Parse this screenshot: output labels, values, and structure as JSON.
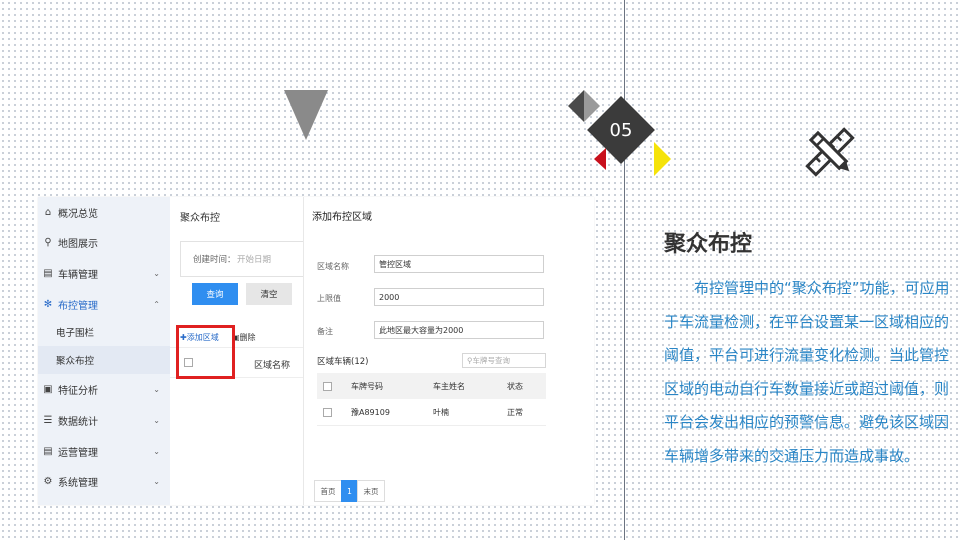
{
  "slide": {
    "number": "05",
    "title": "聚众布控",
    "description": "布控管理中的“聚众布控”功能，可应用于车流量检测，在平台设置某一区域相应的阈值，平台可进行流量变化检测。当此管控区域的电动自行车数量接近或超过阈值，则平台会发出相应的预警信息。避免该区域因车辆增多带来的交通压力而造成事故。",
    "icon": "ruler-pencil-icon",
    "colors": {
      "accent_red": "#c8101c",
      "accent_yellow": "#f5e30a",
      "text_blue": "#2a86c6",
      "dark": "#3b3b3b"
    }
  },
  "screenshot": {
    "sidebar": {
      "items": [
        {
          "label": "概况总览",
          "icon": "home-icon"
        },
        {
          "label": "地图展示",
          "icon": "map-pin-icon"
        },
        {
          "label": "车辆管理",
          "icon": "clipboard-icon"
        },
        {
          "label": "布控管理",
          "icon": "snowflake-icon"
        },
        {
          "label": "特征分析",
          "icon": "chart-icon"
        },
        {
          "label": "数据统计",
          "icon": "list-icon"
        },
        {
          "label": "运营管理",
          "icon": "clipboard-icon"
        },
        {
          "label": "系统管理",
          "icon": "gear-icon"
        }
      ],
      "subitems": [
        {
          "label": "电子围栏"
        },
        {
          "label": "聚众布控"
        }
      ],
      "chevron_down": "⌄",
      "chevron_up": "⌃"
    },
    "main": {
      "title": "聚众布控",
      "filter_label": "创建时间：",
      "filter_placeholder": "开始日期",
      "query_button": "查询",
      "clear_button": "清空",
      "add_label": "添加区域",
      "delete_label": "删除",
      "column_name": "区域名称"
    },
    "panel": {
      "title": "添加布控区域",
      "fields": [
        {
          "label": "区域名称",
          "value": "管控区域"
        },
        {
          "label": "上限值",
          "value": "2000"
        },
        {
          "label": "备注",
          "value": "此地区最大容量为2000"
        }
      ],
      "vehicles_label": "区域车辆(12)",
      "search_placeholder": "车牌号查询",
      "table": {
        "headers": [
          "车牌号码",
          "车主姓名",
          "状态"
        ],
        "rows": [
          [
            "豫A89109",
            "叶楠",
            "正常"
          ]
        ]
      },
      "pager": {
        "first": "首页",
        "current": "1",
        "last": "末页"
      }
    }
  }
}
